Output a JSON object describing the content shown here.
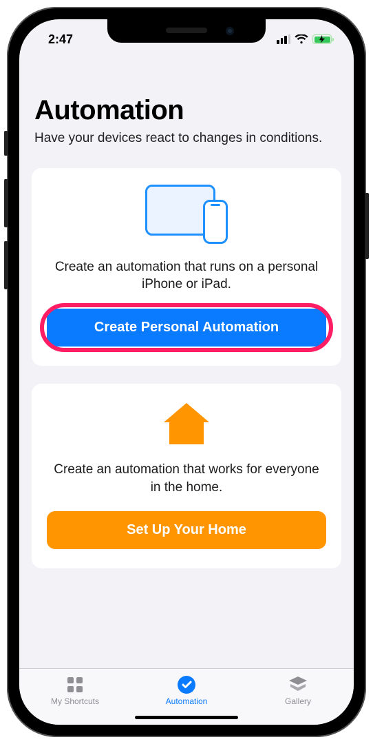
{
  "statusbar": {
    "time": "2:47"
  },
  "header": {
    "title": "Automation",
    "subtitle": "Have your devices react to changes in conditions."
  },
  "cards": {
    "personal": {
      "description": "Create an automation that runs on a personal iPhone or iPad.",
      "button": "Create Personal Automation"
    },
    "home": {
      "description": "Create an automation that works for everyone in the home.",
      "button": "Set Up Your Home"
    }
  },
  "tabs": {
    "shortcuts": "My Shortcuts",
    "automation": "Automation",
    "gallery": "Gallery"
  },
  "colors": {
    "accent_blue": "#0a7aff",
    "accent_orange": "#ff9500",
    "highlight": "#ff1d63"
  }
}
